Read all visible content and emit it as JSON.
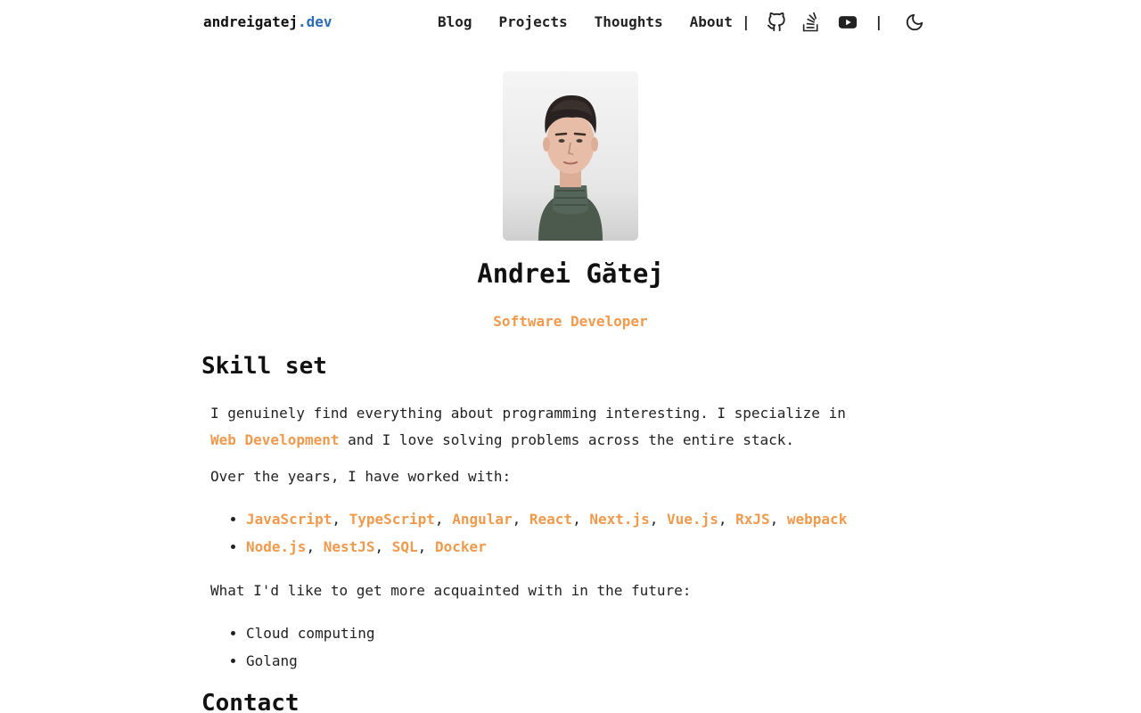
{
  "header": {
    "logo_main": "andreigatej",
    "logo_tld": ".dev",
    "nav": [
      "Blog",
      "Projects",
      "Thoughts",
      "About"
    ],
    "separator": "|",
    "social_icons": [
      "github-icon",
      "stackoverflow-icon",
      "youtube-icon"
    ],
    "theme_icon": "moon-icon"
  },
  "profile": {
    "name": "Andrei Gătej",
    "role": "Software Developer"
  },
  "skills": {
    "title": "Skill set",
    "intro_before": "I genuinely find everything about programming interesting. I specialize in ",
    "intro_link": "Web Development",
    "intro_after": " and I love solving problems across the entire stack.",
    "worked_with_label": "Over the years, I have worked with:",
    "worked_with": [
      [
        "JavaScript",
        "TypeScript",
        "Angular",
        "React",
        "Next.js",
        "Vue.js",
        "RxJS",
        "webpack"
      ],
      [
        "Node.js",
        "NestJS",
        "SQL",
        "Docker"
      ]
    ],
    "future_label": "What I'd like to get more acquainted with in the future:",
    "future": [
      "Cloud computing",
      "Golang"
    ]
  },
  "contact": {
    "title": "Contact"
  },
  "colors": {
    "accent": "#ef9a4d",
    "logo_tld": "#2a6db5"
  }
}
